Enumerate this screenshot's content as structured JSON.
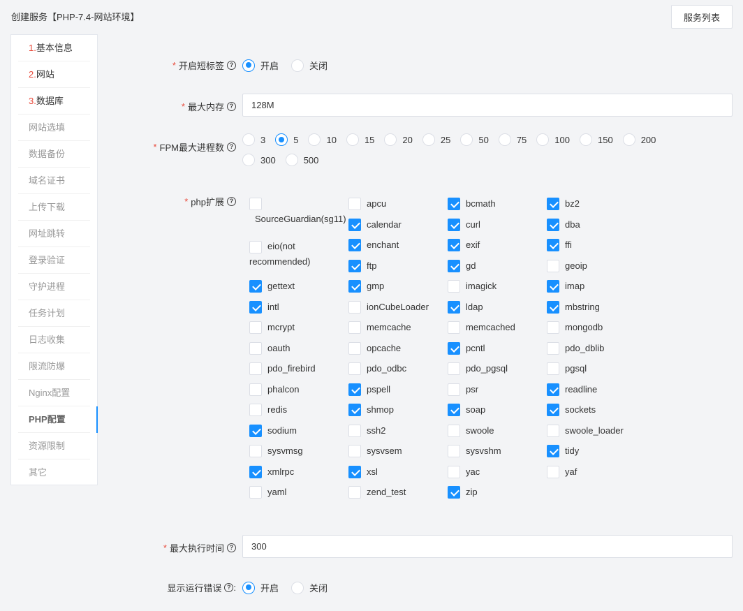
{
  "page": {
    "title": "创建服务【PHP-7.4-网站环境】",
    "service_list_button": "服务列表"
  },
  "sidebar": {
    "items": [
      {
        "num": "1.",
        "label": "基本信息",
        "state": "done"
      },
      {
        "num": "2.",
        "label": "网站",
        "state": "done"
      },
      {
        "num": "3.",
        "label": "数据库",
        "state": "done"
      },
      {
        "num": "",
        "label": "网站选填",
        "state": "normal"
      },
      {
        "num": "",
        "label": "数据备份",
        "state": "normal"
      },
      {
        "num": "",
        "label": "域名证书",
        "state": "normal"
      },
      {
        "num": "",
        "label": "上传下载",
        "state": "normal"
      },
      {
        "num": "",
        "label": "网址跳转",
        "state": "normal"
      },
      {
        "num": "",
        "label": "登录验证",
        "state": "normal"
      },
      {
        "num": "",
        "label": "守护进程",
        "state": "normal"
      },
      {
        "num": "",
        "label": "任务计划",
        "state": "normal"
      },
      {
        "num": "",
        "label": "日志收集",
        "state": "normal"
      },
      {
        "num": "",
        "label": "限流防爆",
        "state": "normal"
      },
      {
        "num": "",
        "label": "Nginx配置",
        "state": "normal"
      },
      {
        "num": "",
        "label": "PHP配置",
        "state": "active"
      },
      {
        "num": "",
        "label": "资源限制",
        "state": "normal"
      },
      {
        "num": "",
        "label": "其它",
        "state": "normal"
      }
    ]
  },
  "form": {
    "short_tag": {
      "label": "开启短标签",
      "options": [
        "开启",
        "关闭"
      ],
      "selected": "开启"
    },
    "memory_limit": {
      "label": "最大内存",
      "value": "128M"
    },
    "fpm_max": {
      "label": "FPM最大进程数",
      "options": [
        "3",
        "5",
        "10",
        "15",
        "20",
        "25",
        "50",
        "75",
        "100",
        "150",
        "200",
        "300",
        "500"
      ],
      "selected": "5"
    },
    "php_ext": {
      "label": "php扩展",
      "items": [
        {
          "name": "SourceGuardian(sg11)",
          "checked": false
        },
        {
          "name": "apcu",
          "checked": false
        },
        {
          "name": "bcmath",
          "checked": true
        },
        {
          "name": "bz2",
          "checked": true
        },
        {
          "name": "calendar",
          "checked": true
        },
        {
          "name": "curl",
          "checked": true
        },
        {
          "name": "dba",
          "checked": true
        },
        {
          "name": "eio(not recommended)",
          "checked": false
        },
        {
          "name": "enchant",
          "checked": true
        },
        {
          "name": "exif",
          "checked": true
        },
        {
          "name": "ffi",
          "checked": true
        },
        {
          "name": "ftp",
          "checked": true
        },
        {
          "name": "gd",
          "checked": true
        },
        {
          "name": "geoip",
          "checked": false
        },
        {
          "name": "gettext",
          "checked": true
        },
        {
          "name": "gmp",
          "checked": true
        },
        {
          "name": "imagick",
          "checked": false
        },
        {
          "name": "imap",
          "checked": true
        },
        {
          "name": "intl",
          "checked": true
        },
        {
          "name": "ionCubeLoader",
          "checked": false
        },
        {
          "name": "ldap",
          "checked": true
        },
        {
          "name": "mbstring",
          "checked": true
        },
        {
          "name": "mcrypt",
          "checked": false
        },
        {
          "name": "memcache",
          "checked": false
        },
        {
          "name": "memcached",
          "checked": false
        },
        {
          "name": "mongodb",
          "checked": false
        },
        {
          "name": "oauth",
          "checked": false
        },
        {
          "name": "opcache",
          "checked": false
        },
        {
          "name": "pcntl",
          "checked": true
        },
        {
          "name": "pdo_dblib",
          "checked": false
        },
        {
          "name": "pdo_firebird",
          "checked": false
        },
        {
          "name": "pdo_odbc",
          "checked": false
        },
        {
          "name": "pdo_pgsql",
          "checked": false
        },
        {
          "name": "pgsql",
          "checked": false
        },
        {
          "name": "phalcon",
          "checked": false
        },
        {
          "name": "pspell",
          "checked": true
        },
        {
          "name": "psr",
          "checked": false
        },
        {
          "name": "readline",
          "checked": true
        },
        {
          "name": "redis",
          "checked": false
        },
        {
          "name": "shmop",
          "checked": true
        },
        {
          "name": "soap",
          "checked": true
        },
        {
          "name": "sockets",
          "checked": true
        },
        {
          "name": "sodium",
          "checked": true
        },
        {
          "name": "ssh2",
          "checked": false
        },
        {
          "name": "swoole",
          "checked": false
        },
        {
          "name": "swoole_loader",
          "checked": false
        },
        {
          "name": "sysvmsg",
          "checked": false
        },
        {
          "name": "sysvsem",
          "checked": false
        },
        {
          "name": "sysvshm",
          "checked": false
        },
        {
          "name": "tidy",
          "checked": true
        },
        {
          "name": "xmlrpc",
          "checked": true
        },
        {
          "name": "xsl",
          "checked": true
        },
        {
          "name": "yac",
          "checked": false
        },
        {
          "name": "yaf",
          "checked": false
        },
        {
          "name": "yaml",
          "checked": false
        },
        {
          "name": "zend_test",
          "checked": false
        },
        {
          "name": "zip",
          "checked": true
        }
      ]
    },
    "max_exec": {
      "label": "最大执行时间",
      "value": "300"
    },
    "display_errors": {
      "label": "显示运行错误",
      "options": [
        "开启",
        "关闭"
      ],
      "selected": "开启"
    }
  },
  "colors": {
    "accent": "#1890ff",
    "required": "#e84a3b"
  },
  "icons": {
    "help": "help-circle-icon"
  }
}
